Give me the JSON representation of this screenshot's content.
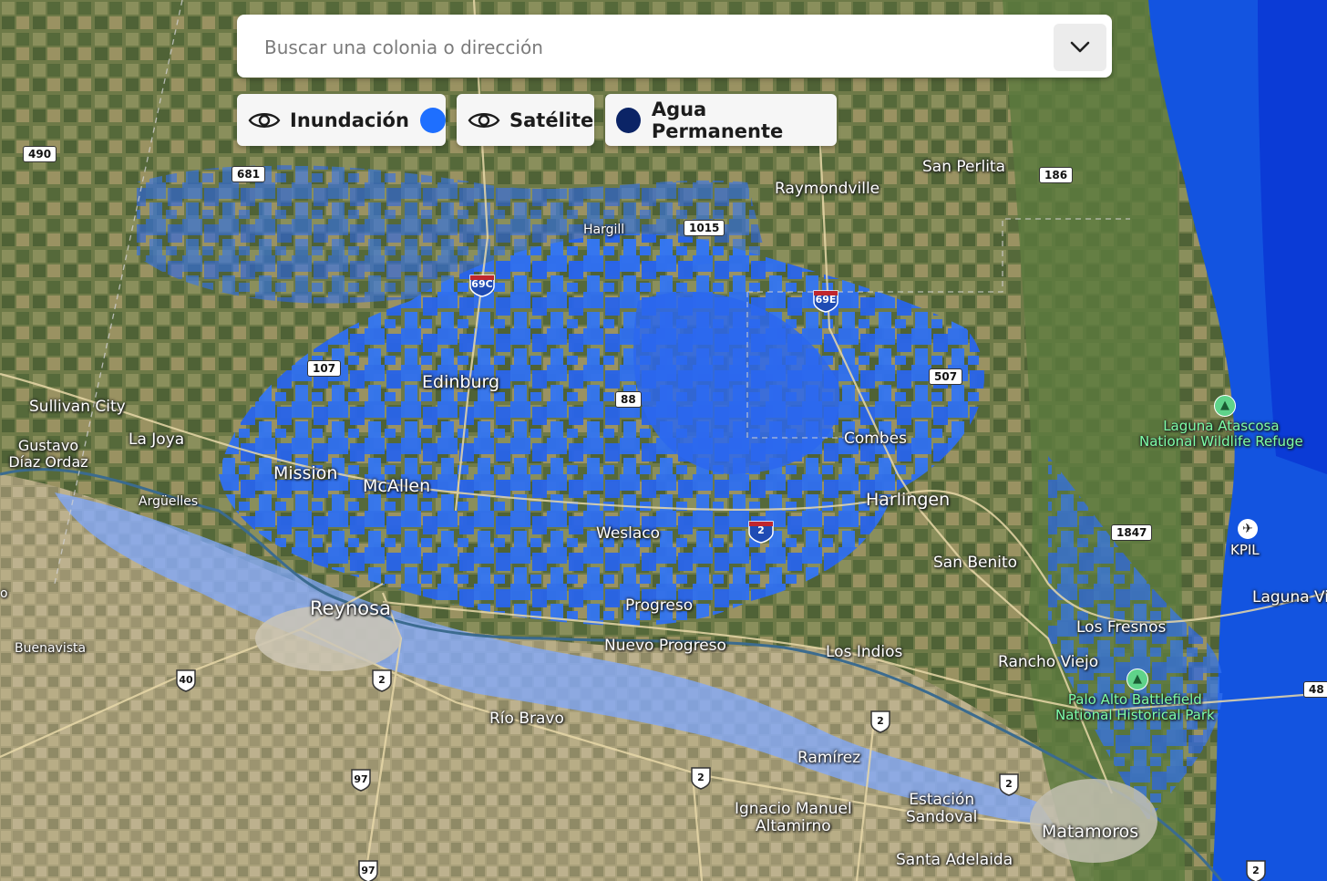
{
  "search": {
    "placeholder": "Buscar una colonia o dirección"
  },
  "icons": {
    "dropdown": "chevron-down-icon",
    "eye": "eye-icon"
  },
  "layers": [
    {
      "label": "Inundación",
      "color": "#1e6fff",
      "visible": true
    },
    {
      "label": "Satélite",
      "visible": true
    },
    {
      "label": "Agua Permanente",
      "color": "#0b2466"
    }
  ],
  "places": {
    "sullivan_city": "Sullivan City",
    "gustavo": "Gustavo\nDíaz Ordaz",
    "la_joya": "La Joya",
    "mission": "Mission",
    "mcallen": "McAllen",
    "edinburg": "Edinburg",
    "arguelles": "Argüelles",
    "reynosa": "Reynosa",
    "buenavista": "Buenavista",
    "hargill": "Hargill",
    "raymondville": "Raymondville",
    "san_perlita": "San Perlita",
    "combes": "Combes",
    "harlingen": "Harlingen",
    "weslaco": "Weslaco",
    "progreso": "Progreso",
    "nuevo_progreso": "Nuevo Progreso",
    "los_indios": "Los Indios",
    "san_benito": "San Benito",
    "los_fresnos": "Los Fresnos",
    "rancho_viejo": "Rancho Viejo",
    "rio_bravo": "Río Bravo",
    "ramirez": "Ramírez",
    "ignacio": "Ignacio Manuel\nAltamirno",
    "estacion": "Estación\nSandoval",
    "santa_adelaida": "Santa Adelaida",
    "matamoros": "Matamoros",
    "laguna_vi": "Laguna Vi",
    "kpil": "KPIL",
    "o_left": "o"
  },
  "pois": {
    "laguna_atascosa": "Laguna Atascosa\nNational Wildlife Refuge",
    "palo_alto": "Palo Alto Battlefield\nNational Historical Park"
  },
  "routes": {
    "r490": "490",
    "r681": "681",
    "r1015": "1015",
    "r186": "186",
    "r107": "107",
    "r88": "88",
    "r507": "507",
    "r1847": "1847",
    "r48": "48",
    "i69c": "69C",
    "i69e": "69E",
    "i2": "2",
    "mx40": "40",
    "mx2a": "2",
    "mx2b": "2",
    "mx2c": "2",
    "mx2d": "2",
    "mx97a": "97",
    "mx97b": "97",
    "mx2e": "2"
  }
}
